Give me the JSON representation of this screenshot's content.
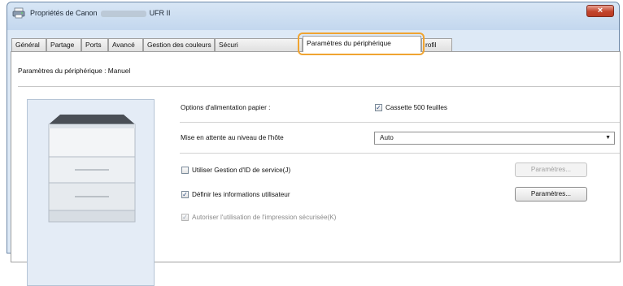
{
  "window": {
    "title_prefix": "Propriétés de Canon",
    "title_suffix": "UFR II",
    "close_label": "×"
  },
  "tabs": [
    {
      "label": "Général"
    },
    {
      "label": "Partage"
    },
    {
      "label": "Ports"
    },
    {
      "label": "Avancé"
    },
    {
      "label": "Gestion des couleurs"
    },
    {
      "label": "Sécuri"
    },
    {
      "label": "Paramètres du périphérique",
      "active": true
    },
    {
      "label": "rofil"
    }
  ],
  "panel": {
    "heading": "Paramètres du périphérique : Manuel",
    "paper_feed_label": "Options d'alimentation papier :",
    "cassette": {
      "label": "Cassette 500 feuilles",
      "checked": true
    },
    "host_spool_label": "Mise en attente au niveau de l'hôte",
    "host_spool_value": "Auto",
    "dept_id": {
      "label": "Utiliser Gestion d'ID de service(J)",
      "checked": false,
      "button": "Paramètres..."
    },
    "user_info": {
      "label": "Définir les informations utilisateur",
      "checked": true,
      "button": "Paramètres..."
    },
    "secure_print": {
      "label": "Autoriser l'utilisation de l'impression sécurisée(K)",
      "checked": true,
      "disabled": true
    }
  },
  "icons": {
    "check": "✓",
    "dropdown": "▼"
  }
}
